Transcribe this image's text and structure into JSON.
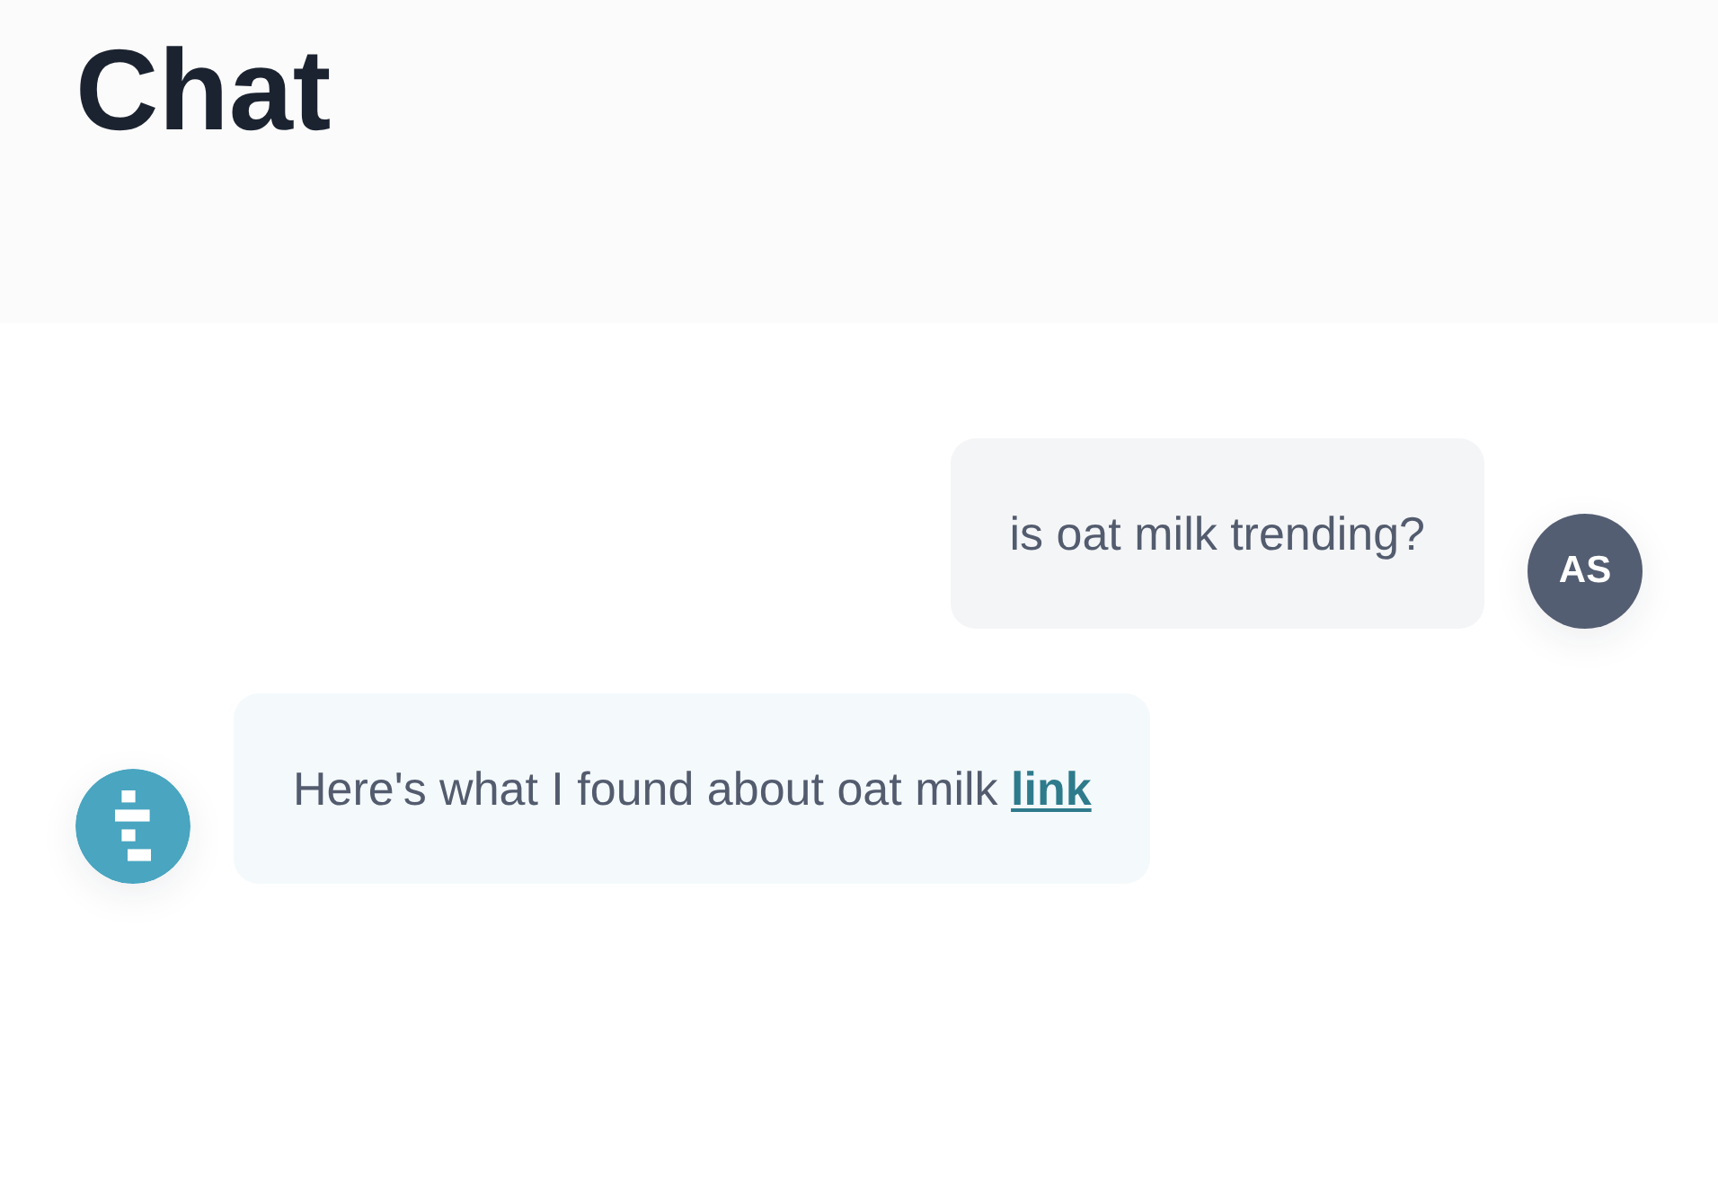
{
  "header": {
    "title": "Chat"
  },
  "messages": [
    {
      "kind": "user",
      "text": "is oat milk trending?",
      "avatar": "AS"
    },
    {
      "kind": "bot",
      "text": "Here's what I found about oat milk",
      "link": "link"
    }
  ]
}
